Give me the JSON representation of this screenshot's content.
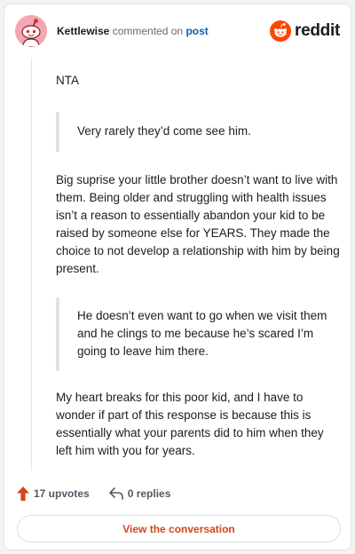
{
  "comment": {
    "username": "Kettlewise",
    "action": "commented on",
    "target": "post",
    "avatar_icon": "reddit-snoo-avatar-icon",
    "avatar_color": "#f4a6b3"
  },
  "brand": {
    "name": "reddit",
    "icon": "reddit-logo-icon",
    "color": "#ff4500"
  },
  "body": {
    "p1": "NTA",
    "quote1": "Very rarely they’d come see him.",
    "p2": "Big suprise your little brother doesn’t want to live with them. Being older and struggling with health issues isn’t a reason to essentially abandon your kid to be raised by someone else for YEARS. They made the choice to not develop a relationship with him by being present.",
    "quote2": "He doesn’t even want to go when we visit them and he clings to me because he’s scared I’m going to leave him there.",
    "p3": "My heart breaks for this poor kid, and I have to wonder if part of this response is because this is essentially what your parents did to him when they left him with you for years."
  },
  "footer": {
    "upvotes": "17 upvotes",
    "upvote_icon": "upvote-arrow-icon",
    "replies": "0 replies",
    "reply_icon": "reply-arrow-icon",
    "cta": "View the conversation",
    "accent": "#d4451b"
  }
}
